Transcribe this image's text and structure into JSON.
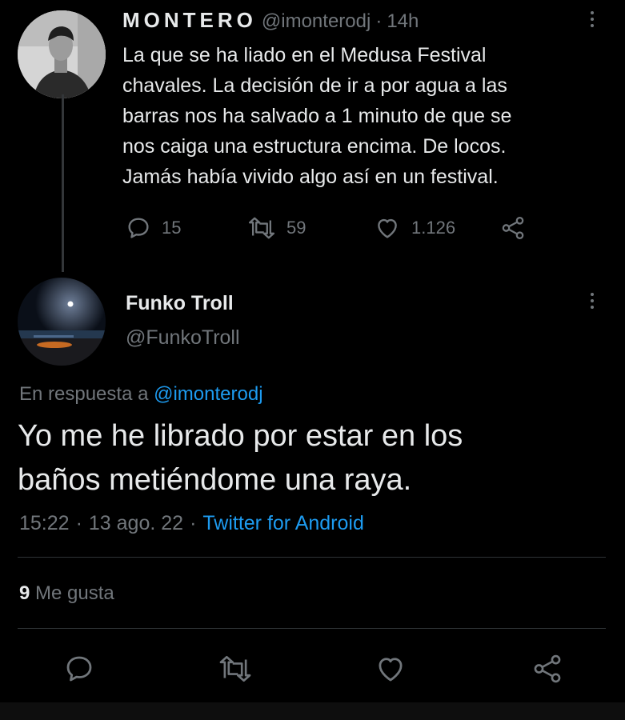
{
  "parent_tweet": {
    "display_name": "MONTERO",
    "handle": "@imonterodj",
    "separator": "·",
    "time": "14h",
    "text_lines": [
      "La que se ha liado en el Medusa Festival",
      "chavales. La decisión de ir a por agua a las",
      "barras nos ha salvado a 1 minuto de que se",
      "nos caiga una estructura encima. De locos.",
      "Jamás había vivido algo así en un festival."
    ],
    "replies": "15",
    "retweets": "59",
    "likes": "1.126"
  },
  "reply_tweet": {
    "display_name": "Funko Troll",
    "handle": "@FunkoTroll",
    "reply_to_prefix": "En respuesta a",
    "reply_to_handle": "@imonterodj",
    "text_lines": [
      "Yo me he librado por estar en los",
      "baños metiéndome una raya."
    ],
    "time": "15:22",
    "date": "13 ago. 22",
    "sep1": "·",
    "sep2": "·",
    "source": "Twitter for Android",
    "likes_count": "9",
    "likes_label": "Me gusta"
  },
  "icons": [
    "reply-icon",
    "retweet-icon",
    "like-icon",
    "share-icon",
    "more-options-icon"
  ],
  "colors": {
    "background": "#000000",
    "text": "#e7e9ea",
    "muted": "#71767b",
    "link": "#1d9bf0"
  }
}
